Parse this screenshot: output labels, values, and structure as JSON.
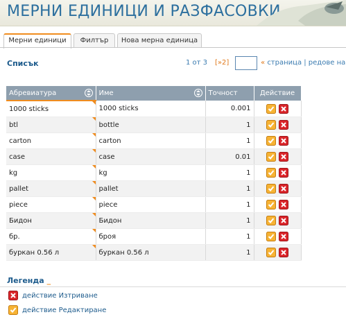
{
  "page_title": "МЕРНИ ЕДИНИЦИ И РАЗФАСОВКИ",
  "tabs": [
    {
      "label": "Мерни единици",
      "active": true
    },
    {
      "label": "Филтър",
      "active": false
    },
    {
      "label": "Нова мерна единица",
      "active": false
    }
  ],
  "section_title": "Списък",
  "pager": {
    "page_info": "1 от 3",
    "next_link": "[»2]",
    "page_input_value": "",
    "page_label_arrow": "«",
    "page_label": "страница | редове на с"
  },
  "table": {
    "headers": [
      "Абревиатура",
      "Име",
      "Точност",
      "Действие"
    ],
    "rows": [
      {
        "abbr": "1000 sticks",
        "name": "1000 sticks",
        "precision": "0.001"
      },
      {
        "abbr": "btl",
        "name": "bottle",
        "precision": "1"
      },
      {
        "abbr": "carton",
        "name": "carton",
        "precision": "1"
      },
      {
        "abbr": "case",
        "name": "case",
        "precision": "0.01"
      },
      {
        "abbr": "kg",
        "name": "kg",
        "precision": "1"
      },
      {
        "abbr": "pallet",
        "name": "pallet",
        "precision": "1"
      },
      {
        "abbr": "piece",
        "name": "piece",
        "precision": "1"
      },
      {
        "abbr": "Бидон",
        "name": "Бидон",
        "precision": "1"
      },
      {
        "abbr": "бр.",
        "name": "броя",
        "precision": "1"
      },
      {
        "abbr": "буркан 0.56 л",
        "name": "буркан 0.56 л",
        "precision": "1"
      }
    ]
  },
  "legend": {
    "title": "Легенда",
    "items": [
      {
        "icon": "delete-icon",
        "label": "действие Изтриване"
      },
      {
        "icon": "edit-icon",
        "label": "действие Редактиране"
      }
    ]
  },
  "colors": {
    "accent": "#f08c1e",
    "title": "#2c6f9e",
    "header_bg": "#8e9fae",
    "delete": "#d9252a"
  }
}
